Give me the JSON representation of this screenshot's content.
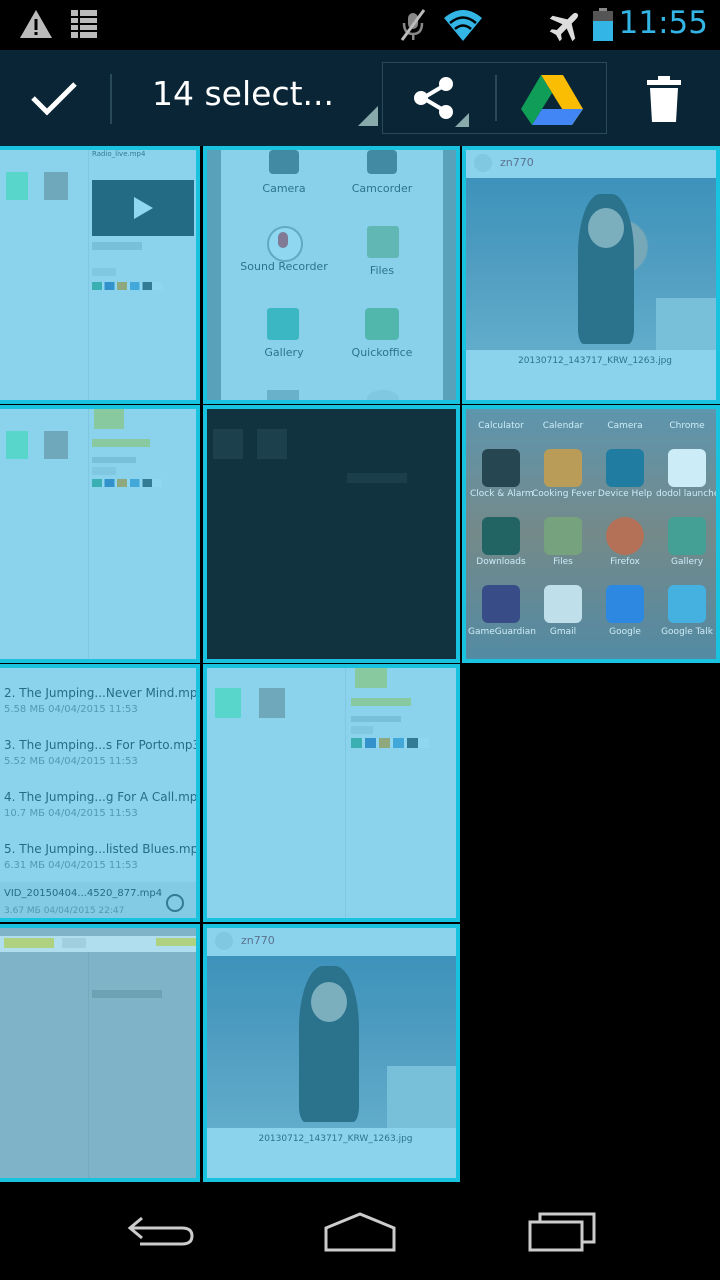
{
  "status_bar": {
    "time": "11:55",
    "icons": [
      "warning-icon",
      "storage-icon",
      "mute-icon",
      "wifi-icon",
      "airplane-icon",
      "battery-icon"
    ]
  },
  "action_bar": {
    "selection_label": "14 select...",
    "icons": [
      "check-icon",
      "share-icon",
      "drive-icon",
      "trash-icon"
    ]
  },
  "tiles": {
    "t1": {
      "title": "Radio_live.mp4"
    },
    "t2": {
      "apps": [
        "Camera",
        "Camcorder",
        "Sound Recorder",
        "Files",
        "Gallery",
        "Quickoffice"
      ]
    },
    "t3": {
      "user": "zn770",
      "filename": "20130712_143717_KRW_1263.jpg"
    },
    "t6": {
      "apps": [
        "Calculator",
        "Calendar",
        "Camera",
        "Chrome",
        "Clock & Alarm",
        "Cooking Fever",
        "Device Help",
        "dodol launcher",
        "Downloads",
        "Files",
        "Firefox",
        "Gallery",
        "GameGuardian",
        "Gmail",
        "Google",
        "Google Talk"
      ]
    },
    "t7": {
      "files": [
        {
          "name": "2. The Jumping...Never Mind.mp3",
          "meta": "5.58 МБ 04/04/2015 11:53"
        },
        {
          "name": "3. The Jumping...s For Porto.mp3",
          "meta": "5.52 МБ 04/04/2015 11:53"
        },
        {
          "name": "4. The Jumping...g For A Call.mp3",
          "meta": "10.7 МБ 04/04/2015 11:53"
        },
        {
          "name": "5. The Jumping...listed Blues.mp3",
          "meta": "6.31 МБ 04/04/2015 11:53"
        },
        {
          "name": "VID_20150404...4520_877.mp4",
          "meta": "3.67 МБ 04/04/2015 22:47"
        }
      ]
    },
    "t10": {
      "user": "zn770",
      "filename": "20130712_143717_KRW_1263.jpg"
    }
  },
  "colors": {
    "accent": "#33b5e5",
    "selection_border": "#19c3e0",
    "action_bar": "#0a2636"
  }
}
